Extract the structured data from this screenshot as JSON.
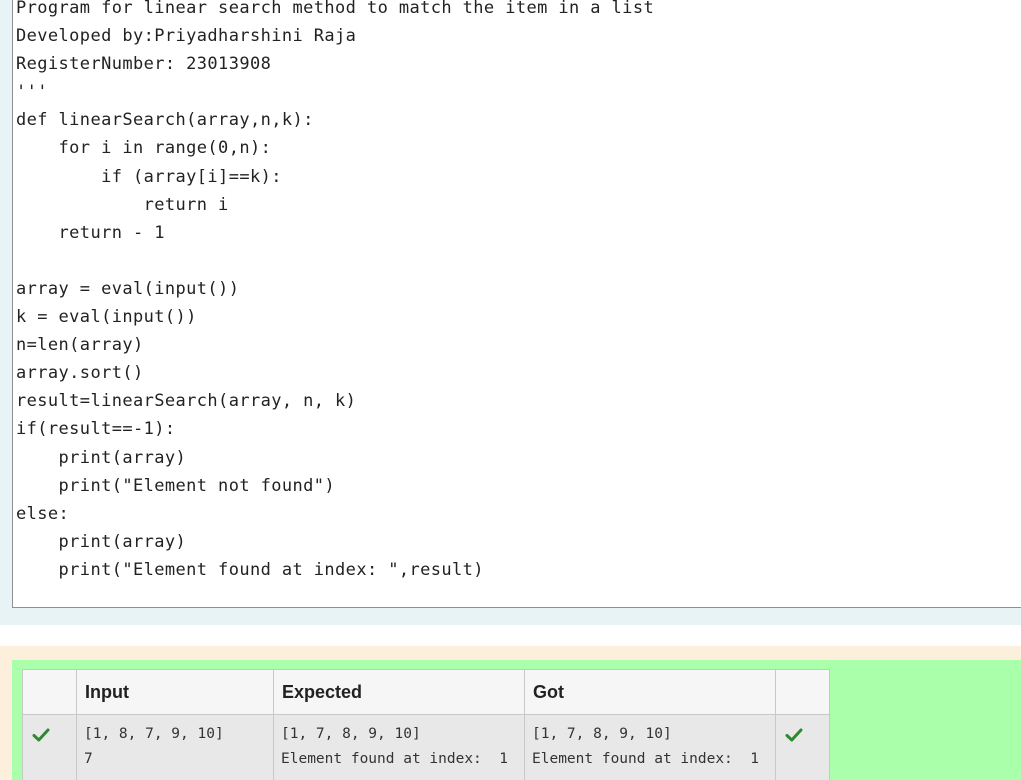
{
  "code": {
    "lines": [
      "Program for linear search method to match the item in a list",
      "Developed by:Priyadharshini Raja",
      "RegisterNumber: 23013908",
      "'''",
      "def linearSearch(array,n,k):",
      "    for i in range(0,n):",
      "        if (array[i]==k):",
      "            return i",
      "    return - 1",
      "",
      "array = eval(input())",
      "k = eval(input())",
      "n=len(array)",
      "array.sort()",
      "result=linearSearch(array, n, k)",
      "if(result==-1):",
      "    print(array)",
      "    print(\"Element not found\")",
      "else:",
      "    print(array)",
      "    print(\"Element found at index: \",result)"
    ]
  },
  "results": {
    "headers": {
      "status": "",
      "input": "Input",
      "expected": "Expected",
      "got": "Got",
      "status2": ""
    },
    "rows": [
      {
        "status_icon": "check-icon",
        "input": "[1, 8, 7, 9, 10]\n7",
        "expected": "[1, 7, 8, 9, 10]\nElement found at index:  1",
        "got": "[1, 7, 8, 9, 10]\nElement found at index:  1",
        "status2_icon": "check-icon"
      }
    ],
    "pass_color": "#aaffaa",
    "check_color": "#2f8a2f"
  }
}
